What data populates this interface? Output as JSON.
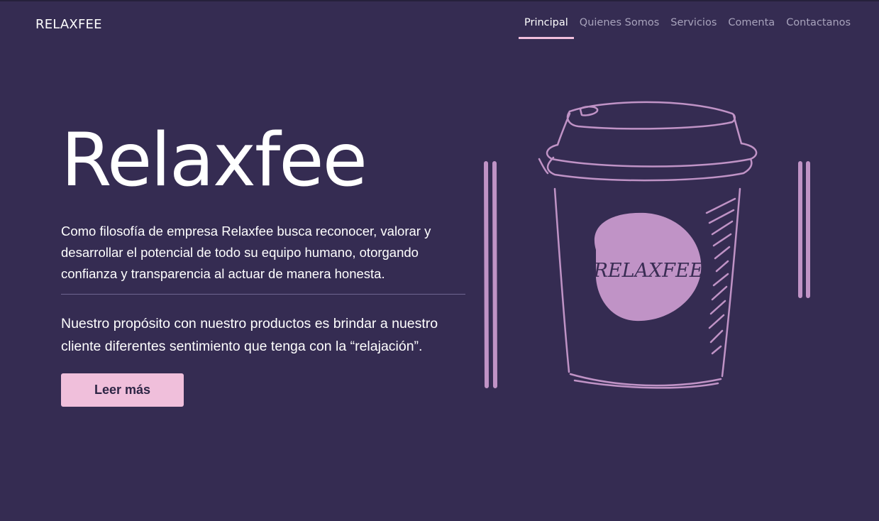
{
  "header": {
    "brand": "RELAXFEE",
    "nav": [
      {
        "label": "Principal",
        "active": true
      },
      {
        "label": "Quienes Somos",
        "active": false
      },
      {
        "label": "Servicios",
        "active": false
      },
      {
        "label": "Comenta",
        "active": false
      },
      {
        "label": "Contactanos",
        "active": false
      }
    ]
  },
  "hero": {
    "title": "Relaxfee",
    "paragraph1": "Como filosofía de empresa Relaxfee busca reconocer, valorar y desarrollar el potencial de todo su equipo humano, otorgando confianza y transparencia al actuar de manera honesta.",
    "paragraph2": "Nuestro propósito con nuestro productos es brindar a nuestro cliente diferentes sentimiento que tenga con la “relajación”.",
    "cta_label": "Leer más"
  },
  "illustration": {
    "cup_logo_text": "RELAXFEE",
    "icon": "coffee-cup-illustration"
  },
  "colors": {
    "background": "#352c52",
    "accent_pink": "#f0bfdb",
    "illustration_lilac": "#c093c6",
    "nav_inactive": "#a8a3bc"
  }
}
